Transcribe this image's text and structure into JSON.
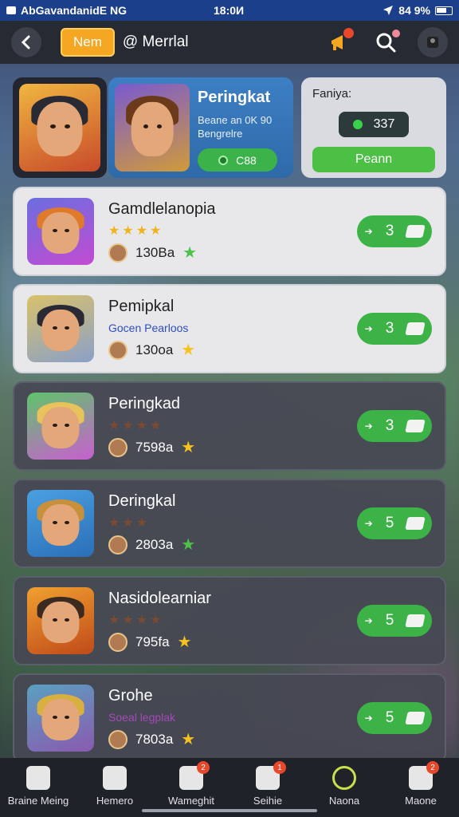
{
  "status_bar": {
    "carrier": "AbGavandanidE NG",
    "time": "18:0И",
    "battery": "84 9%"
  },
  "top_bar": {
    "new_badge": "Nem",
    "title": "@ Merrlal"
  },
  "featured": {
    "card_title": "Peringkat",
    "card_subtitle_line1": "Beane an 0K 90",
    "card_subtitle_line2": "Bengrelre",
    "card_pill": "C88",
    "rank_label": "Faniya:",
    "rank_value": "337",
    "rank_button": "Peann"
  },
  "list": [
    {
      "name": "Gamdlelanopia",
      "sub": "",
      "stars": 4,
      "stars_dim": false,
      "count": "130Ba",
      "meta_star": "green",
      "btn": "3",
      "theme": "light",
      "colors": {
        "bg1": "#6b6ee0",
        "bg2": "#c24bd1",
        "hair": "#e07a2b"
      }
    },
    {
      "name": "Pemipkal",
      "sub": "Gocen Pearloos",
      "stars": 0,
      "stars_dim": false,
      "count": "130oa",
      "meta_star": "yellow",
      "btn": "3",
      "theme": "light",
      "colors": {
        "bg1": "#d9c16a",
        "bg2": "#8aa0c8",
        "hair": "#2a2a35"
      }
    },
    {
      "name": "Peringkad",
      "sub": "",
      "stars": 4,
      "stars_dim": true,
      "count": "7598a",
      "meta_star": "yellow",
      "btn": "3",
      "theme": "dark",
      "colors": {
        "bg1": "#5fc46a",
        "bg2": "#c85fd0",
        "hair": "#e8c25a"
      }
    },
    {
      "name": "Deringkal",
      "sub": "",
      "stars": 3,
      "stars_dim": true,
      "count": "2803a",
      "meta_star": "green",
      "btn": "5",
      "theme": "dark",
      "colors": {
        "bg1": "#4aa0e0",
        "bg2": "#2a6fb8",
        "hair": "#c8903a"
      }
    },
    {
      "name": "Nasidolearniar",
      "sub": "",
      "stars": 4,
      "stars_dim": true,
      "count": "795fa",
      "meta_star": "yellow",
      "btn": "5",
      "theme": "dark",
      "colors": {
        "bg1": "#f0a030",
        "bg2": "#c04a1a",
        "hair": "#3a2a20"
      }
    },
    {
      "name": "Grohe",
      "sub": "Soeal legplak",
      "stars": 0,
      "stars_dim": false,
      "count": "7803a",
      "meta_star": "yellow",
      "btn": "5",
      "theme": "dark",
      "colors": {
        "bg1": "#5aa0c0",
        "bg2": "#8a5ab0",
        "hair": "#d8b040"
      }
    }
  ],
  "bottom_nav": [
    {
      "label": "Braine Meing",
      "badge": ""
    },
    {
      "label": "Hemero",
      "badge": ""
    },
    {
      "label": "Wameghit",
      "badge": "2"
    },
    {
      "label": "Seihie",
      "badge": "1"
    },
    {
      "label": "Naona",
      "badge": ""
    },
    {
      "label": "Maone",
      "badge": "2"
    }
  ]
}
